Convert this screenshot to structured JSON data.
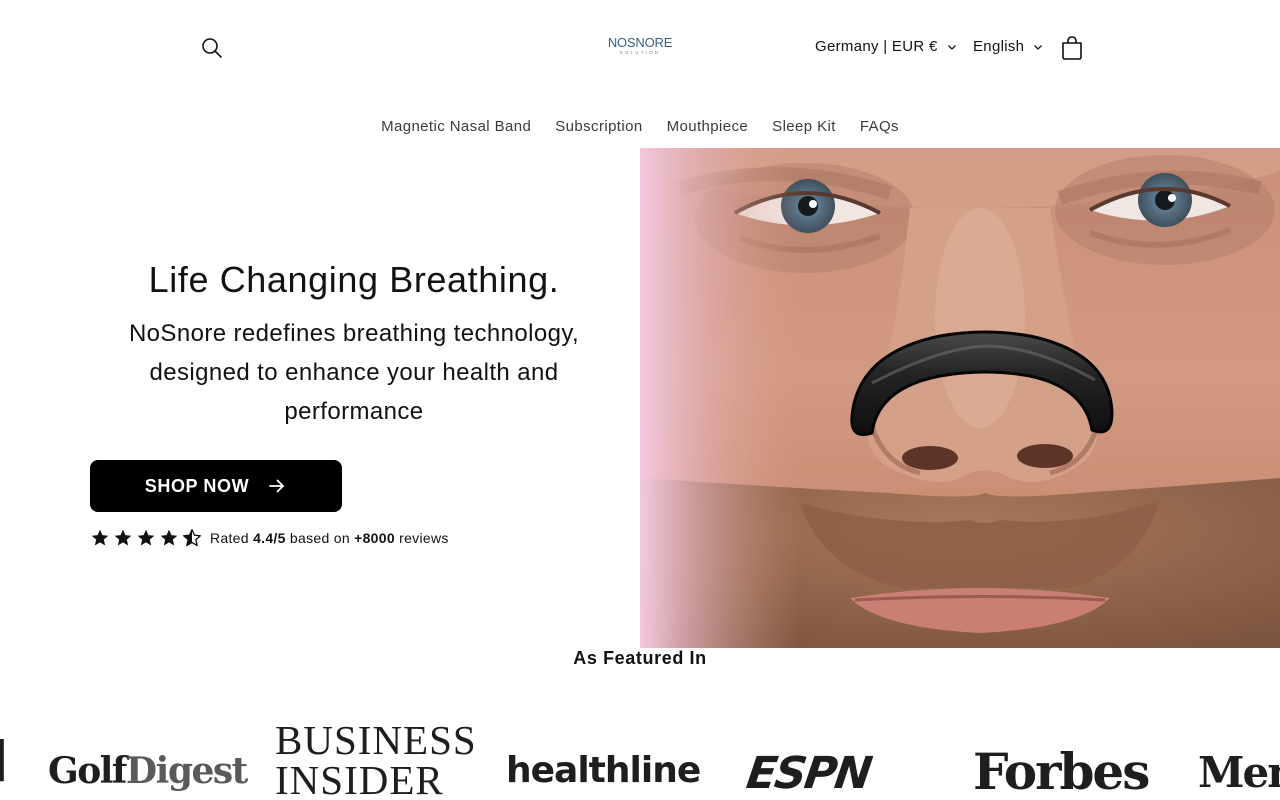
{
  "header": {
    "logo_text_left": "NOSN",
    "logo_text_o": "O",
    "logo_text_right": "RE",
    "logo_subtext": "SOLUTION",
    "locale_label": "Germany | EUR €",
    "language_label": "English"
  },
  "nav": {
    "items": [
      {
        "label": "Magnetic Nasal Band"
      },
      {
        "label": "Subscription"
      },
      {
        "label": "Mouthpiece"
      },
      {
        "label": "Sleep Kit"
      },
      {
        "label": "FAQs"
      }
    ]
  },
  "hero": {
    "title": "Life Changing Breathing.",
    "subtitle": "NoSnore redefines breathing technology, designed to enhance your health and performance",
    "cta_label": "SHOP NOW",
    "rating": {
      "stars": 4.5,
      "prefix": "Rated ",
      "score": "4.4/5",
      "middle": " based on ",
      "count": "+8000",
      "suffix": " reviews"
    }
  },
  "featured": {
    "title": "As Featured In",
    "logos": [
      {
        "name": "partial-logo",
        "text": "|\ns"
      },
      {
        "name": "Golf Digest",
        "text_a": "Golf",
        "text_b": "Digest"
      },
      {
        "name": "Business Insider",
        "line1": "BUSINESS",
        "line2": "INSIDER"
      },
      {
        "name": "healthline",
        "text": "healthline"
      },
      {
        "name": "ESPN",
        "text": "ESPN"
      },
      {
        "name": "Forbes",
        "text": "Forbes"
      },
      {
        "name": "Men's Health",
        "text": "Men's"
      }
    ]
  },
  "colors": {
    "logo_blue": "#3b5f86",
    "button_bg": "#000000",
    "text": "#121212"
  }
}
